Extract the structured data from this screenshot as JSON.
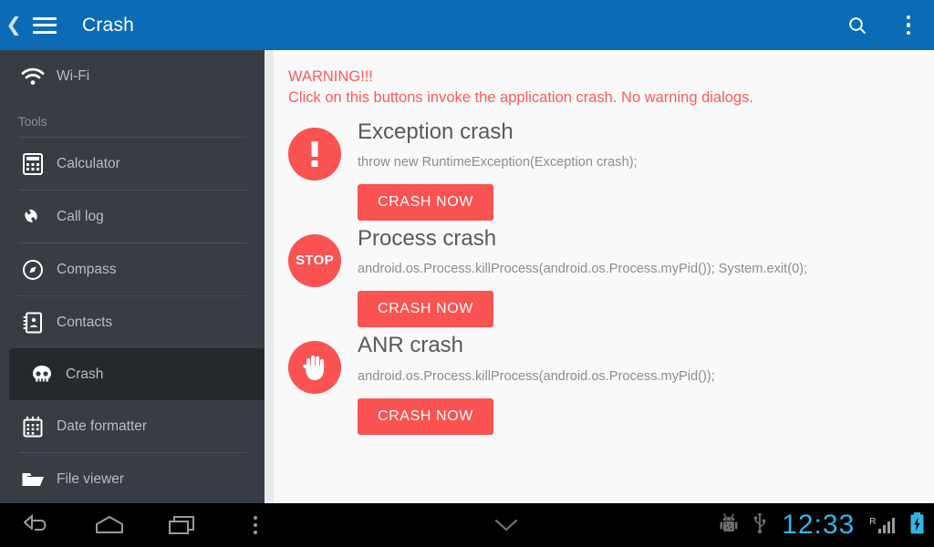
{
  "actionbar": {
    "back_icon": "chevron-left-icon",
    "menu_icon": "hamburger-menu-icon",
    "title": "Crash",
    "search_icon": "search-icon",
    "overflow_icon": "overflow-menu-icon"
  },
  "sidebar": {
    "top_items": [
      {
        "label": "Wi-Fi",
        "icon": "wifi-icon",
        "selected": false
      }
    ],
    "section_label": "Tools",
    "items": [
      {
        "label": "Calculator",
        "icon": "calculator-icon",
        "selected": false
      },
      {
        "label": "Call log",
        "icon": "phone-icon",
        "selected": false
      },
      {
        "label": "Compass",
        "icon": "compass-icon",
        "selected": false
      },
      {
        "label": "Contacts",
        "icon": "contacts-book-icon",
        "selected": false
      },
      {
        "label": "Crash",
        "icon": "skull-icon",
        "selected": true
      },
      {
        "label": "Date formatter",
        "icon": "calendar-icon",
        "selected": false
      },
      {
        "label": "File viewer",
        "icon": "folder-icon",
        "selected": false
      }
    ]
  },
  "content": {
    "warning_title": "WARNING!!!",
    "warning_text": "Click on this buttons invoke the application crash. No warning dialogs.",
    "warning_color": "#fb5b5b",
    "accent_color": "#fb5252",
    "crashes": [
      {
        "title": "Exception crash",
        "code": "throw new RuntimeException(Exception crash);",
        "button": "CRASH NOW",
        "icon": "exclamation-circle-icon",
        "badge_text": ""
      },
      {
        "title": "Process crash",
        "code": "android.os.Process.killProcess(android.os.Process.myPid()); System.exit(0);",
        "button": "CRASH NOW",
        "icon": "stop-sign-icon",
        "badge_text": "STOP"
      },
      {
        "title": "ANR crash",
        "code": "android.os.Process.killProcess(android.os.Process.myPid());",
        "button": "CRASH NOW",
        "icon": "hand-palm-icon",
        "badge_text": ""
      }
    ]
  },
  "navbar": {
    "back_icon": "back-arrow-icon",
    "home_icon": "home-icon",
    "recents_icon": "recent-apps-icon",
    "overflow_icon": "overflow-menu-icon",
    "collapse_icon": "chevron-down-icon",
    "debug_icon": "android-debug-icon",
    "usb_icon": "usb-icon",
    "clock": "12:33",
    "roaming_label": "R",
    "signal_icon": "signal-bars-icon",
    "battery_icon": "battery-charging-icon",
    "clock_color": "#33b5e5"
  }
}
